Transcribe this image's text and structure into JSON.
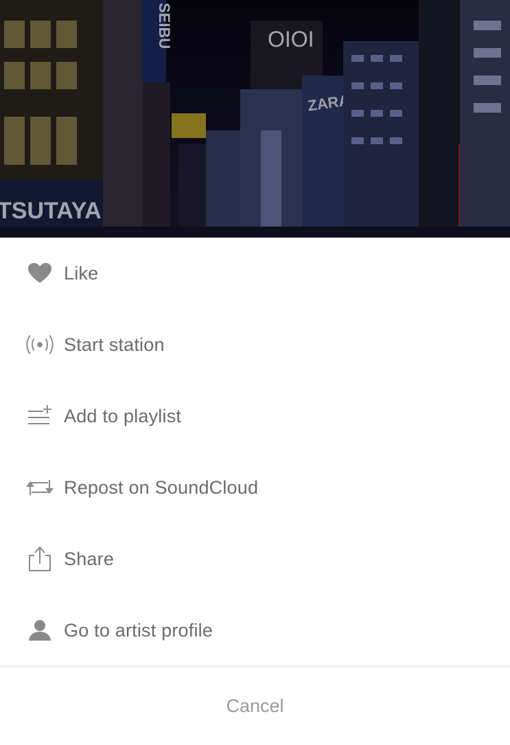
{
  "artwork": {
    "signs": [
      "SEIBU",
      "OIOI",
      "ZARA",
      "TSUTAYA"
    ]
  },
  "menu": {
    "items": [
      {
        "label": "Like",
        "icon": "heart-icon"
      },
      {
        "label": "Start station",
        "icon": "station-icon"
      },
      {
        "label": "Add to playlist",
        "icon": "add-to-playlist-icon"
      },
      {
        "label": "Repost on SoundCloud",
        "icon": "repost-icon"
      },
      {
        "label": "Share",
        "icon": "share-icon"
      },
      {
        "label": "Go to artist profile",
        "icon": "user-icon"
      }
    ],
    "cancel_label": "Cancel"
  },
  "colors": {
    "icon": "#8a8a8a",
    "label": "#6b6b6b",
    "cancel": "#9a9a9a",
    "divider": "#e2e2e2"
  }
}
